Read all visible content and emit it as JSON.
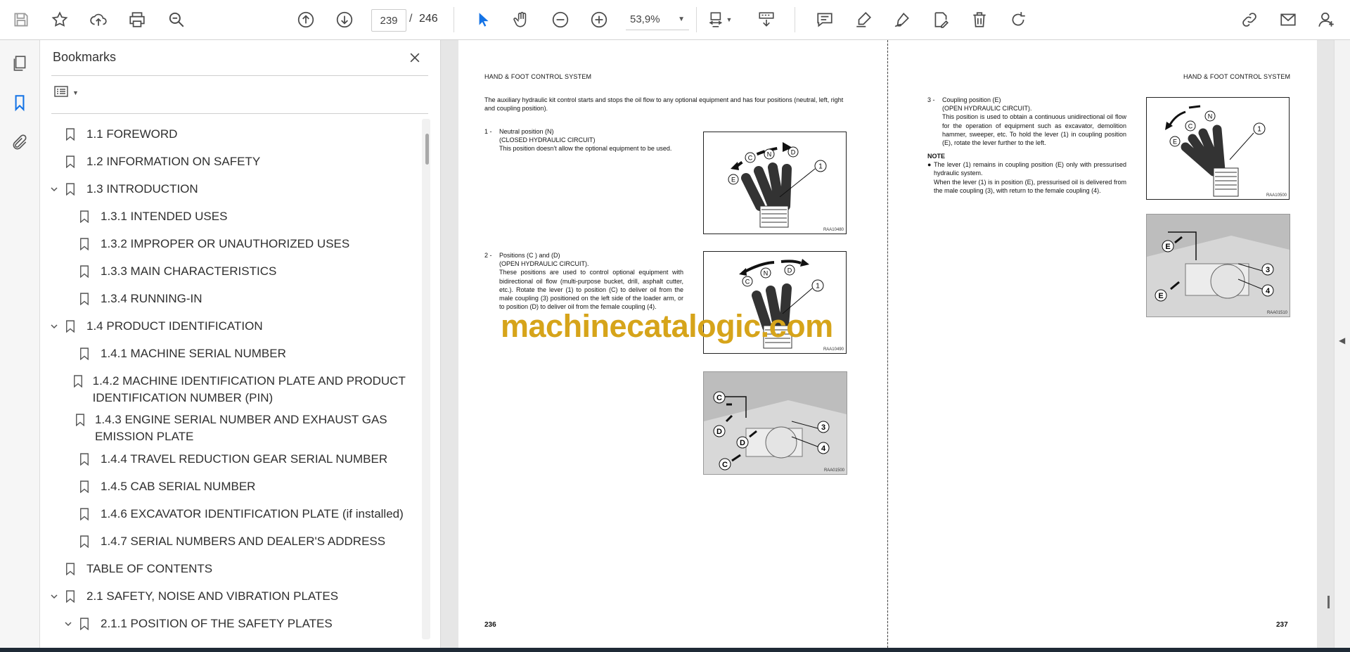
{
  "toolbar": {
    "icons": [
      "save-icon",
      "bookmark-star-icon",
      "upload-icon",
      "print-icon",
      "search-zoom-icon",
      "page-up-icon",
      "page-down-icon",
      "zoom-out-icon",
      "zoom-in-icon",
      "select-cursor-icon",
      "hand-tool-icon",
      "fit-page-icon",
      "scroll-mode-icon",
      "comment-icon",
      "highlight-icon",
      "sign-icon",
      "edit-pdf-icon",
      "delete-icon",
      "rotate-icon",
      "share-link-icon",
      "email-icon",
      "account-icon"
    ],
    "current_page": "239",
    "page_separator": "/",
    "total_pages": "246",
    "zoom": "53,9%"
  },
  "bookmarks": {
    "title": "Bookmarks",
    "items": [
      {
        "label": "1.1 FOREWORD",
        "level": 0,
        "expand": "none"
      },
      {
        "label": "1.2 INFORMATION ON SAFETY",
        "level": 0,
        "expand": "none"
      },
      {
        "label": "1.3 INTRODUCTION",
        "level": 0,
        "expand": "open"
      },
      {
        "label": "1.3.1 INTENDED USES",
        "level": 1,
        "expand": "none"
      },
      {
        "label": "1.3.2 IMPROPER OR UNAUTHORIZED USES",
        "level": 1,
        "expand": "none"
      },
      {
        "label": "1.3.3 MAIN CHARACTERISTICS",
        "level": 1,
        "expand": "none"
      },
      {
        "label": "1.3.4 RUNNING-IN",
        "level": 1,
        "expand": "none"
      },
      {
        "label": "1.4 PRODUCT IDENTIFICATION",
        "level": 0,
        "expand": "open"
      },
      {
        "label": "1.4.1 MACHINE SERIAL NUMBER",
        "level": 1,
        "expand": "none"
      },
      {
        "label": "1.4.2 MACHINE IDENTIFICATION PLATE AND PRODUCT IDENTIFICATION NUMBER (PIN)",
        "level": 1,
        "expand": "none"
      },
      {
        "label": "1.4.3 ENGINE SERIAL NUMBER AND EXHAUST GAS EMISSION PLATE",
        "level": 1,
        "expand": "none"
      },
      {
        "label": "1.4.4 TRAVEL REDUCTION GEAR SERIAL NUMBER",
        "level": 1,
        "expand": "none"
      },
      {
        "label": "1.4.5 CAB SERIAL NUMBER",
        "level": 1,
        "expand": "none"
      },
      {
        "label": "1.4.6 EXCAVATOR IDENTIFICATION PLATE (if installed)",
        "level": 1,
        "expand": "none"
      },
      {
        "label": "1.4.7 SERIAL NUMBERS AND DEALER'S ADDRESS",
        "level": 1,
        "expand": "none"
      },
      {
        "label": "TABLE OF CONTENTS",
        "level": 0,
        "expand": "none"
      },
      {
        "label": "2.1 SAFETY, NOISE AND VIBRATION PLATES",
        "level": 0,
        "expand": "open"
      },
      {
        "label": "2.1.1 POSITION OF THE SAFETY PLATES",
        "level": 1,
        "expand": "open"
      }
    ]
  },
  "doc": {
    "left": {
      "header": "HAND & FOOT CONTROL SYSTEM",
      "intro": "The auxiliary hydraulic kit control starts and stops the oil flow to any optional equipment and has four positions (neutral, left, right and coupling position).",
      "item1_num": "1 -",
      "item1_title": "Neutral position (N)",
      "item1_sub": "(CLOSED HYDRAULIC CIRCUIT)",
      "item1_body": "This position doesn't allow the optional equipment to be used.",
      "item2_num": "2 -",
      "item2_title": "Positions (C ) and (D)",
      "item2_sub": "(OPEN HYDRAULIC CIRCUIT).",
      "item2_body": "These positions are used to control optional equipment with bidirectional oil flow (multi-purpose bucket, drill, asphalt cutter, etc.). Rotate the lever (1) to position (C) to deliver oil from the male coupling (3) positioned on the left side of the loader arm, or to position (D) to deliver oil from the female coupling (4).",
      "fig1_code": "RAA10480",
      "fig2_code": "RAA10490",
      "fig3_code": "RAA01500",
      "page_number": "236"
    },
    "right": {
      "header": "HAND & FOOT CONTROL SYSTEM",
      "item3_num": "3 -",
      "item3_title": "Coupling position (E)",
      "item3_sub": "(OPEN HYDRAULIC CIRCUIT).",
      "item3_body": "This position is used to obtain a continuous unidirectional oil flow for the operation of equipment such as excavator, demolition hammer, sweeper, etc. To hold the lever (1) in coupling position (E), rotate the lever further to the left.",
      "note_label": "NOTE",
      "note_body1": "The lever (1) remains in coupling position (E) only with pressurised hydraulic system.",
      "note_body2": "When the lever (1) is in position (E), pressurised oil is delivered from the male coupling (3), with return to the female coupling (4).",
      "fig4_code": "RAA10500",
      "fig5_code": "RAA01510",
      "page_number": "237"
    },
    "fig_labels": {
      "n": "N",
      "c": "C",
      "d": "D",
      "e": "E",
      "one": "1",
      "three": "3",
      "four": "4"
    }
  },
  "watermark": "machinecatalogic.com"
}
